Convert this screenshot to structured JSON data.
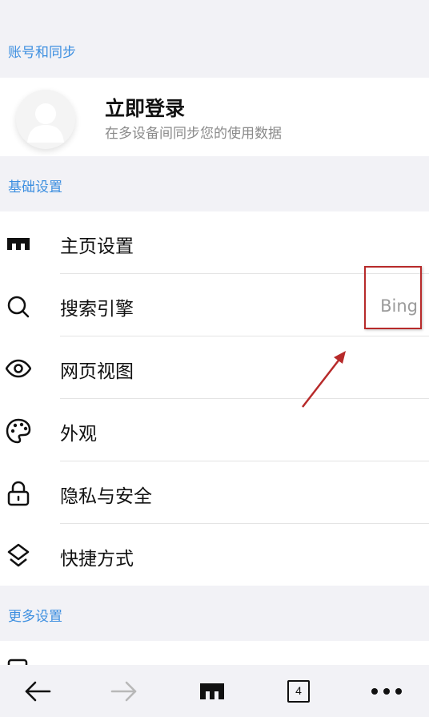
{
  "sections": {
    "account": "账号和同步",
    "basic": "基础设置",
    "more": "更多设置"
  },
  "account": {
    "title": "立即登录",
    "subtitle": "在多设备间同步您的使用数据"
  },
  "basic_items": [
    {
      "label": "主页设置",
      "icon": "home-icon"
    },
    {
      "label": "搜索引擎",
      "icon": "search-icon",
      "value": "Bing"
    },
    {
      "label": "网页视图",
      "icon": "eye-icon"
    },
    {
      "label": "外观",
      "icon": "palette-icon"
    },
    {
      "label": "隐私与安全",
      "icon": "lock-icon"
    },
    {
      "label": "快捷方式",
      "icon": "shortcut-icon"
    }
  ],
  "bottom_bar": {
    "tab_count": "4"
  },
  "colors": {
    "accent": "#3d8fe0",
    "annotation": "#b72a2a"
  }
}
